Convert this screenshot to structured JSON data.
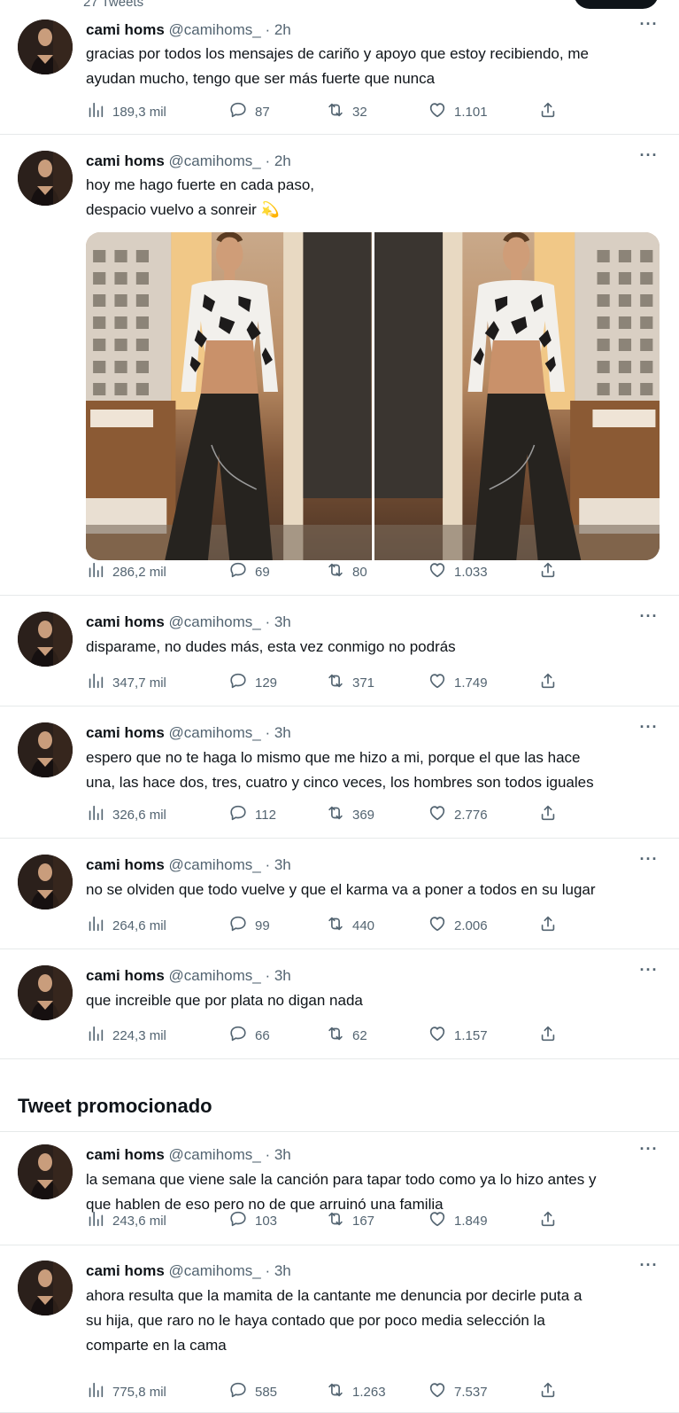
{
  "header": {
    "tweet_count": "27 Tweets"
  },
  "author": {
    "name": "cami homs",
    "handle": "@camihoms_"
  },
  "promoted_label": "Tweet promocionado",
  "tweets": [
    {
      "time": "2h",
      "text": "gracias por todos los mensajes de cariño y apoyo que estoy recibiendo, me\nayudan mucho, tengo que ser más fuerte que nunca",
      "views": "189,3 mil",
      "replies": "87",
      "retweets": "32",
      "likes": "1.101"
    },
    {
      "time": "2h",
      "text": "hoy me hago fuerte en cada paso,\ndespacio vuelvo a sonreir 💫",
      "views": "286,2 mil",
      "replies": "69",
      "retweets": "80",
      "likes": "1.033",
      "has_media": true
    },
    {
      "time": "3h",
      "text": "disparame, no dudes más, esta vez conmigo no podrás",
      "views": "347,7 mil",
      "replies": "129",
      "retweets": "371",
      "likes": "1.749"
    },
    {
      "time": "3h",
      "text": "espero que no te haga lo mismo que me hizo a mi, porque el que las hace\nuna, las hace dos, tres, cuatro y cinco veces, los hombres son todos iguales",
      "views": "326,6 mil",
      "replies": "112",
      "retweets": "369",
      "likes": "2.776"
    },
    {
      "time": "3h",
      "text": "no se olviden que todo vuelve y que el karma va a poner a todos en su lugar",
      "views": "264,6 mil",
      "replies": "99",
      "retweets": "440",
      "likes": "2.006"
    },
    {
      "time": "3h",
      "text": "que increible que por plata no digan nada",
      "views": "224,3 mil",
      "replies": "66",
      "retweets": "62",
      "likes": "1.157"
    },
    {
      "time": "3h",
      "text": "la semana que viene sale la canción para tapar todo como ya lo hizo antes y\nque hablen de eso pero no de que arruinó una familia",
      "views": "243,6 mil",
      "replies": "103",
      "retweets": "167",
      "likes": "1.849"
    },
    {
      "time": "3h",
      "text": "ahora resulta que la mamita de la cantante me denuncia por decirle puta a\nsu hija, que raro no le haya contado que por poco media selección la\ncomparte en la cama",
      "views": "775,8 mil",
      "replies": "585",
      "retweets": "1.263",
      "likes": "7.537"
    }
  ],
  "icons": {
    "views": "views-icon",
    "reply": "reply-icon",
    "retweet": "retweet-icon",
    "like": "like-icon",
    "share": "share-icon",
    "more": "more-icon"
  }
}
